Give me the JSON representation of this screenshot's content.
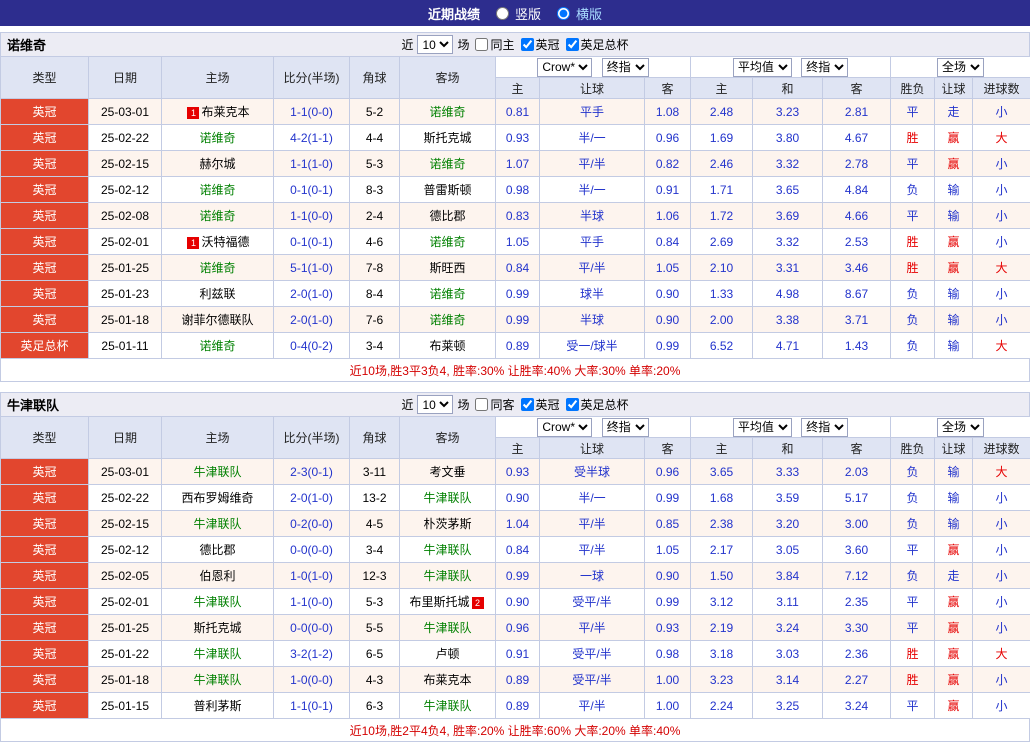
{
  "top_bar": {
    "title": "近期战绩",
    "layout_options": [
      {
        "label": "竖版",
        "selected": false
      },
      {
        "label": "横版",
        "selected": true
      }
    ]
  },
  "filter_labels": {
    "near": "近",
    "games": "场",
    "league1": "英冠",
    "league2": "英足总杯"
  },
  "header_labels": {
    "type": "类型",
    "date": "日期",
    "home": "主场",
    "score": "比分(半场)",
    "corner": "角球",
    "away": "客场",
    "asia_home": "主",
    "asia_handicap": "让球",
    "asia_away": "客",
    "euro_home": "主",
    "euro_draw": "和",
    "euro_away": "客",
    "result_wdl": "胜负",
    "result_handicap": "让球",
    "result_goals": "进球数",
    "select_crown": "Crow*",
    "select_final1": "终指",
    "select_avg": "平均值",
    "select_final2": "终指",
    "select_full": "全场"
  },
  "tables": [
    {
      "team": "诺维奇",
      "near_count": "10",
      "same_side_label": "同主",
      "summary": "近10场,胜3平3负4, 胜率:30% 让胜率:40% 大率:30% 单率:20%",
      "rows": [
        {
          "type": "英冠",
          "date": "25-03-01",
          "home": {
            "name": "布莱克本",
            "badge": "1",
            "badge_side": "left"
          },
          "score": "1-1(0-0)",
          "corner": "5-2",
          "away": {
            "name": "诺维奇",
            "self": true
          },
          "asia": [
            "0.81",
            "平手",
            "1.08"
          ],
          "euro": [
            "2.48",
            "3.23",
            "2.81"
          ],
          "res": [
            "平",
            "走",
            "小"
          ],
          "res_red": [
            false,
            false,
            false
          ]
        },
        {
          "type": "英冠",
          "date": "25-02-22",
          "home": {
            "name": "诺维奇",
            "self": true
          },
          "score": "4-2(1-1)",
          "corner": "4-4",
          "away": {
            "name": "斯托克城"
          },
          "asia": [
            "0.93",
            "半/一",
            "0.96"
          ],
          "euro": [
            "1.69",
            "3.80",
            "4.67"
          ],
          "res": [
            "胜",
            "赢",
            "大"
          ],
          "res_red": [
            true,
            true,
            true
          ]
        },
        {
          "type": "英冠",
          "date": "25-02-15",
          "home": {
            "name": "赫尔城"
          },
          "score": "1-1(1-0)",
          "corner": "5-3",
          "away": {
            "name": "诺维奇",
            "self": true
          },
          "asia": [
            "1.07",
            "平/半",
            "0.82"
          ],
          "euro": [
            "2.46",
            "3.32",
            "2.78"
          ],
          "res": [
            "平",
            "赢",
            "小"
          ],
          "res_red": [
            false,
            true,
            false
          ]
        },
        {
          "type": "英冠",
          "date": "25-02-12",
          "home": {
            "name": "诺维奇",
            "self": true
          },
          "score": "0-1(0-1)",
          "corner": "8-3",
          "away": {
            "name": "普雷斯顿"
          },
          "asia": [
            "0.98",
            "半/一",
            "0.91"
          ],
          "euro": [
            "1.71",
            "3.65",
            "4.84"
          ],
          "res": [
            "负",
            "输",
            "小"
          ],
          "res_red": [
            false,
            false,
            false
          ]
        },
        {
          "type": "英冠",
          "date": "25-02-08",
          "home": {
            "name": "诺维奇",
            "self": true
          },
          "score": "1-1(0-0)",
          "corner": "2-4",
          "away": {
            "name": "德比郡"
          },
          "asia": [
            "0.83",
            "半球",
            "1.06"
          ],
          "euro": [
            "1.72",
            "3.69",
            "4.66"
          ],
          "res": [
            "平",
            "输",
            "小"
          ],
          "res_red": [
            false,
            false,
            false
          ]
        },
        {
          "type": "英冠",
          "date": "25-02-01",
          "home": {
            "name": "沃特福德",
            "badge": "1",
            "badge_side": "left"
          },
          "score": "0-1(0-1)",
          "corner": "4-6",
          "away": {
            "name": "诺维奇",
            "self": true
          },
          "asia": [
            "1.05",
            "平手",
            "0.84"
          ],
          "euro": [
            "2.69",
            "3.32",
            "2.53"
          ],
          "res": [
            "胜",
            "赢",
            "小"
          ],
          "res_red": [
            true,
            true,
            false
          ]
        },
        {
          "type": "英冠",
          "date": "25-01-25",
          "home": {
            "name": "诺维奇",
            "self": true
          },
          "score": "5-1(1-0)",
          "corner": "7-8",
          "away": {
            "name": "斯旺西"
          },
          "asia": [
            "0.84",
            "平/半",
            "1.05"
          ],
          "euro": [
            "2.10",
            "3.31",
            "3.46"
          ],
          "res": [
            "胜",
            "赢",
            "大"
          ],
          "res_red": [
            true,
            true,
            true
          ]
        },
        {
          "type": "英冠",
          "date": "25-01-23",
          "home": {
            "name": "利兹联"
          },
          "score": "2-0(1-0)",
          "corner": "8-4",
          "away": {
            "name": "诺维奇",
            "self": true
          },
          "asia": [
            "0.99",
            "球半",
            "0.90"
          ],
          "euro": [
            "1.33",
            "4.98",
            "8.67"
          ],
          "res": [
            "负",
            "输",
            "小"
          ],
          "res_red": [
            false,
            false,
            false
          ]
        },
        {
          "type": "英冠",
          "date": "25-01-18",
          "home": {
            "name": "谢菲尔德联队"
          },
          "score": "2-0(1-0)",
          "corner": "7-6",
          "away": {
            "name": "诺维奇",
            "self": true
          },
          "asia": [
            "0.99",
            "半球",
            "0.90"
          ],
          "euro": [
            "2.00",
            "3.38",
            "3.71"
          ],
          "res": [
            "负",
            "输",
            "小"
          ],
          "res_red": [
            false,
            false,
            false
          ]
        },
        {
          "type": "英足总杯",
          "date": "25-01-11",
          "home": {
            "name": "诺维奇",
            "self": true
          },
          "score": "0-4(0-2)",
          "corner": "3-4",
          "away": {
            "name": "布莱顿"
          },
          "asia": [
            "0.89",
            "受一/球半",
            "0.99"
          ],
          "euro": [
            "6.52",
            "4.71",
            "1.43"
          ],
          "res": [
            "负",
            "输",
            "大"
          ],
          "res_red": [
            false,
            false,
            true
          ]
        }
      ]
    },
    {
      "team": "牛津联队",
      "near_count": "10",
      "same_side_label": "同客",
      "summary": "近10场,胜2平4负4, 胜率:20% 让胜率:60% 大率:20% 单率:40%",
      "rows": [
        {
          "type": "英冠",
          "date": "25-03-01",
          "home": {
            "name": "牛津联队",
            "self": true
          },
          "score": "2-3(0-1)",
          "corner": "3-11",
          "away": {
            "name": "考文垂"
          },
          "asia": [
            "0.93",
            "受半球",
            "0.96"
          ],
          "euro": [
            "3.65",
            "3.33",
            "2.03"
          ],
          "res": [
            "负",
            "输",
            "大"
          ],
          "res_red": [
            false,
            false,
            true
          ]
        },
        {
          "type": "英冠",
          "date": "25-02-22",
          "home": {
            "name": "西布罗姆维奇"
          },
          "score": "2-0(1-0)",
          "corner": "13-2",
          "away": {
            "name": "牛津联队",
            "self": true
          },
          "asia": [
            "0.90",
            "半/一",
            "0.99"
          ],
          "euro": [
            "1.68",
            "3.59",
            "5.17"
          ],
          "res": [
            "负",
            "输",
            "小"
          ],
          "res_red": [
            false,
            false,
            false
          ]
        },
        {
          "type": "英冠",
          "date": "25-02-15",
          "home": {
            "name": "牛津联队",
            "self": true
          },
          "score": "0-2(0-0)",
          "corner": "4-5",
          "away": {
            "name": "朴茨茅斯"
          },
          "asia": [
            "1.04",
            "平/半",
            "0.85"
          ],
          "euro": [
            "2.38",
            "3.20",
            "3.00"
          ],
          "res": [
            "负",
            "输",
            "小"
          ],
          "res_red": [
            false,
            false,
            false
          ]
        },
        {
          "type": "英冠",
          "date": "25-02-12",
          "home": {
            "name": "德比郡"
          },
          "score": "0-0(0-0)",
          "corner": "3-4",
          "away": {
            "name": "牛津联队",
            "self": true
          },
          "asia": [
            "0.84",
            "平/半",
            "1.05"
          ],
          "euro": [
            "2.17",
            "3.05",
            "3.60"
          ],
          "res": [
            "平",
            "赢",
            "小"
          ],
          "res_red": [
            false,
            true,
            false
          ]
        },
        {
          "type": "英冠",
          "date": "25-02-05",
          "home": {
            "name": "伯恩利"
          },
          "score": "1-0(1-0)",
          "corner": "12-3",
          "away": {
            "name": "牛津联队",
            "self": true
          },
          "asia": [
            "0.99",
            "一球",
            "0.90"
          ],
          "euro": [
            "1.50",
            "3.84",
            "7.12"
          ],
          "res": [
            "负",
            "走",
            "小"
          ],
          "res_red": [
            false,
            false,
            false
          ]
        },
        {
          "type": "英冠",
          "date": "25-02-01",
          "home": {
            "name": "牛津联队",
            "self": true
          },
          "score": "1-1(0-0)",
          "corner": "5-3",
          "away": {
            "name": "布里斯托城",
            "badge": "2",
            "badge_side": "right"
          },
          "asia": [
            "0.90",
            "受平/半",
            "0.99"
          ],
          "euro": [
            "3.12",
            "3.11",
            "2.35"
          ],
          "res": [
            "平",
            "赢",
            "小"
          ],
          "res_red": [
            false,
            true,
            false
          ]
        },
        {
          "type": "英冠",
          "date": "25-01-25",
          "home": {
            "name": "斯托克城"
          },
          "score": "0-0(0-0)",
          "corner": "5-5",
          "away": {
            "name": "牛津联队",
            "self": true
          },
          "asia": [
            "0.96",
            "平/半",
            "0.93"
          ],
          "euro": [
            "2.19",
            "3.24",
            "3.30"
          ],
          "res": [
            "平",
            "赢",
            "小"
          ],
          "res_red": [
            false,
            true,
            false
          ]
        },
        {
          "type": "英冠",
          "date": "25-01-22",
          "home": {
            "name": "牛津联队",
            "self": true
          },
          "score": "3-2(1-2)",
          "corner": "6-5",
          "away": {
            "name": "卢顿"
          },
          "asia": [
            "0.91",
            "受平/半",
            "0.98"
          ],
          "euro": [
            "3.18",
            "3.03",
            "2.36"
          ],
          "res": [
            "胜",
            "赢",
            "大"
          ],
          "res_red": [
            true,
            true,
            true
          ]
        },
        {
          "type": "英冠",
          "date": "25-01-18",
          "home": {
            "name": "牛津联队",
            "self": true
          },
          "score": "1-0(0-0)",
          "corner": "4-3",
          "away": {
            "name": "布莱克本"
          },
          "asia": [
            "0.89",
            "受平/半",
            "1.00"
          ],
          "euro": [
            "3.23",
            "3.14",
            "2.27"
          ],
          "res": [
            "胜",
            "赢",
            "小"
          ],
          "res_red": [
            true,
            true,
            false
          ]
        },
        {
          "type": "英冠",
          "date": "25-01-15",
          "home": {
            "name": "普利茅斯"
          },
          "score": "1-1(0-1)",
          "corner": "6-3",
          "away": {
            "name": "牛津联队",
            "self": true
          },
          "asia": [
            "0.89",
            "平/半",
            "1.00"
          ],
          "euro": [
            "2.24",
            "3.25",
            "3.24"
          ],
          "res": [
            "平",
            "赢",
            "小"
          ],
          "res_red": [
            false,
            true,
            false
          ]
        }
      ]
    }
  ]
}
